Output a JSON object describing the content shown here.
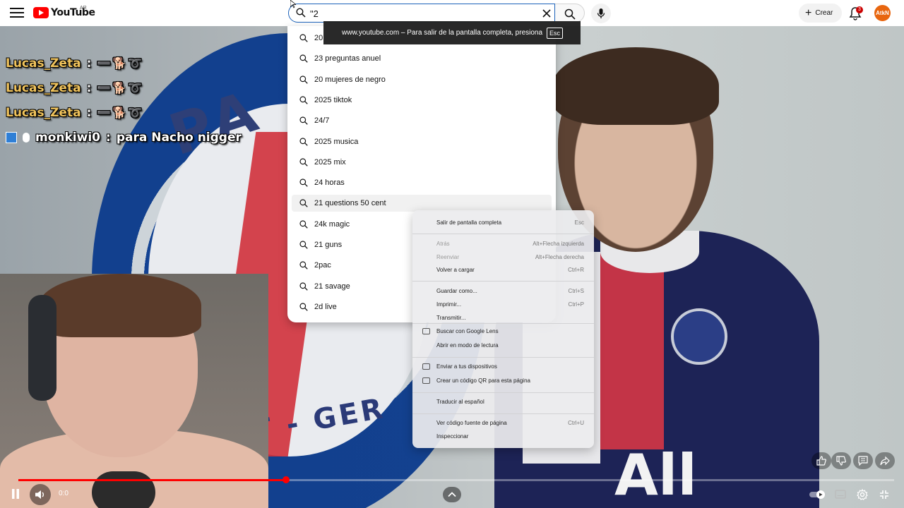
{
  "header": {
    "logo_text": "YouTube",
    "country": "AR",
    "search_value": "\"2",
    "create_label": "Crear",
    "notifications_count": "3",
    "avatar_initials": "AtkN"
  },
  "fullscreen_toast": {
    "message": "www.youtube.com – Para salir de la pantalla completa, presiona",
    "key": "Esc"
  },
  "suggestions": [
    "20",
    "23 preguntas anuel",
    "20 mujeres de negro",
    "2025 tiktok",
    "24/7",
    "2025 musica",
    "2025 mix",
    "24 horas",
    "21 questions 50 cent",
    "24k magic",
    "21 guns",
    "2pac",
    "21 savage",
    "2d live"
  ],
  "context_menu": [
    {
      "label": "Salir de pantalla completa",
      "shortcut": "Esc",
      "disabled": false
    },
    {
      "label": "Atrás",
      "shortcut": "Alt+Flecha izquierda",
      "disabled": true
    },
    {
      "label": "Reenviar",
      "shortcut": "Alt+Flecha derecha",
      "disabled": true
    },
    {
      "label": "Volver a cargar",
      "shortcut": "Ctrl+R",
      "disabled": false
    },
    {
      "label": "Guardar como...",
      "shortcut": "Ctrl+S",
      "disabled": false
    },
    {
      "label": "Imprimir...",
      "shortcut": "Ctrl+P",
      "disabled": false
    },
    {
      "label": "Transmitir...",
      "shortcut": "",
      "disabled": false
    },
    {
      "label": "Buscar con Google Lens",
      "shortcut": "",
      "disabled": false
    },
    {
      "label": "Abrir en modo de lectura",
      "shortcut": "",
      "disabled": false
    },
    {
      "label": "Enviar a tus dispositivos",
      "shortcut": "",
      "disabled": false
    },
    {
      "label": "Crear un código QR para esta página",
      "shortcut": "",
      "disabled": false
    },
    {
      "label": "Traducir al español",
      "shortcut": "",
      "disabled": false
    },
    {
      "label": "Ver código fuente de página",
      "shortcut": "Ctrl+U",
      "disabled": false
    },
    {
      "label": "Inspeccionar",
      "shortcut": "",
      "disabled": false
    }
  ],
  "chat": [
    {
      "user": "Lucas_Zeta",
      "message": ""
    },
    {
      "user": "Lucas_Zeta",
      "message": ""
    },
    {
      "user": "Lucas_Zeta",
      "message": ""
    },
    {
      "user": "monkiwi0",
      "message": "para Nacho nigger"
    }
  ],
  "video": {
    "overlay_text": "PA",
    "overlay_text_bottom": "INT - GER",
    "shirt_text": "All",
    "time": "0:0",
    "progress_fraction": 0.306
  },
  "colors": {
    "accent": "#ff0000",
    "search_border": "#1c62b9"
  }
}
